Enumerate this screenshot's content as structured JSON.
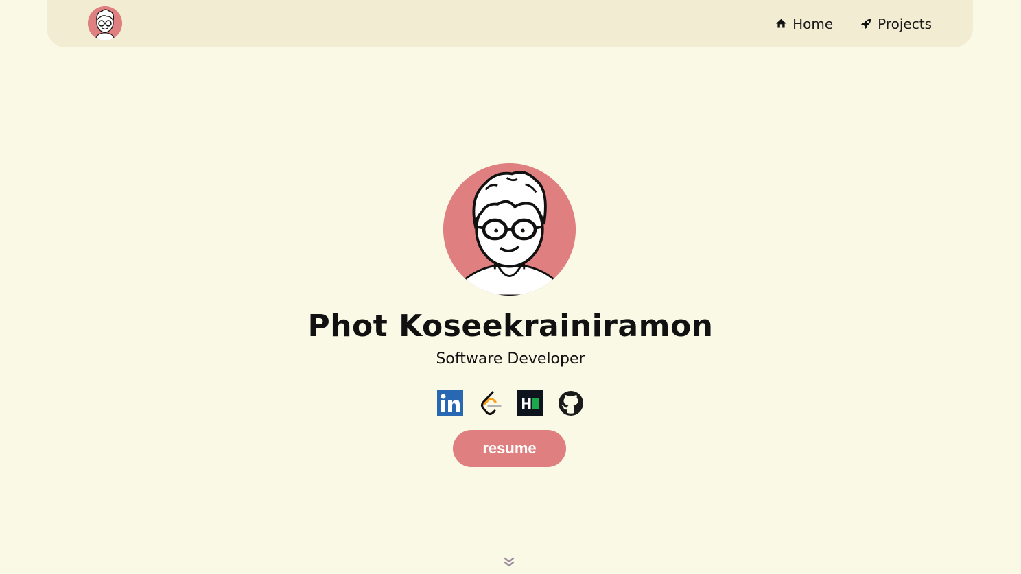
{
  "nav": {
    "avatar_icon": "avatar-icon",
    "links": [
      {
        "label": "Home",
        "icon": "home-icon"
      },
      {
        "label": "Projects",
        "icon": "rocket-icon"
      }
    ]
  },
  "hero": {
    "name": "Phot Koseekrainiramon",
    "role": "Software Developer",
    "avatar_icon": "avatar-icon"
  },
  "socials": [
    {
      "name": "linkedin-icon",
      "color": "#2867b2"
    },
    {
      "name": "leetcode-icon",
      "color": "#f89f1b"
    },
    {
      "name": "hackerrank-icon",
      "color": "#1ba94c"
    },
    {
      "name": "github-icon",
      "color": "#1a1a1a"
    }
  ],
  "resume_button": {
    "label": "resume"
  },
  "scroll_hint_icon": "chevron-double-down-icon",
  "colors": {
    "background": "#f9f9e6",
    "navbar": "#f2ecd3",
    "accent": "#df7f7f"
  }
}
